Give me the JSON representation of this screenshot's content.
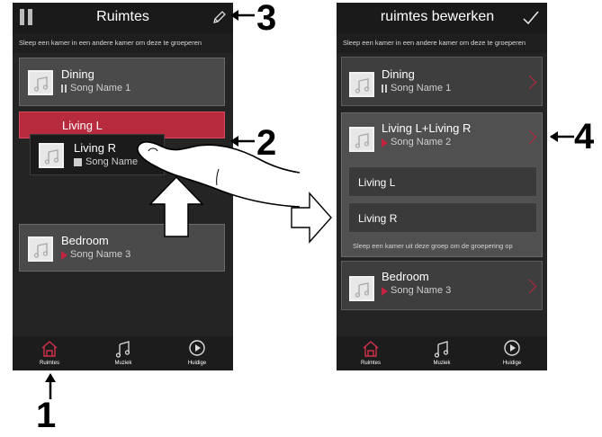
{
  "left": {
    "title": "Ruimtes",
    "hint": "Sleep een kamer in een andere kamer om deze te groeperen",
    "rooms": [
      {
        "name": "Dining",
        "song": "Song Name 1"
      },
      {
        "name": "Living L"
      },
      {
        "name": "Living R",
        "song": "Song Name"
      },
      {
        "name": "Bedroom",
        "song": "Song Name 3"
      }
    ],
    "tabs": [
      "Ruimtes",
      "Muziek",
      "Huidige"
    ]
  },
  "right": {
    "title": "ruimtes bewerken",
    "hint": "Sleep een kamer in een andere kamer om deze te groeperen",
    "rooms": [
      {
        "name": "Dining",
        "song": "Song Name 1"
      },
      {
        "name": "Living L+Living R",
        "song": "Song Name 2"
      },
      {
        "name": "Bedroom",
        "song": "Song Name 3"
      }
    ],
    "sub_rooms": [
      "Living L",
      "Living R"
    ],
    "group_hint": "Sleep een kamer uit deze groep om de groepering op",
    "tabs": [
      "Ruimtes",
      "Muziek",
      "Huidige"
    ]
  },
  "callouts": [
    "1",
    "2",
    "3",
    "4"
  ],
  "colors": {
    "accent": "#c2243f",
    "active_tab": "#d1304b",
    "bg": "#242424"
  }
}
